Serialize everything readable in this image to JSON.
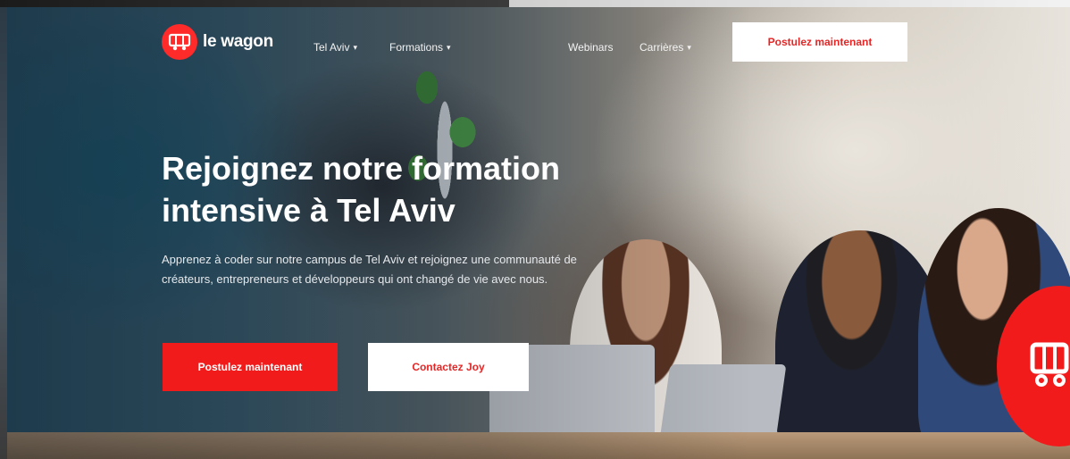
{
  "brand": {
    "name": "le wagon",
    "accent_color": "#f21b1b"
  },
  "header": {
    "nav": [
      {
        "label": "Tel Aviv",
        "has_dropdown": true
      },
      {
        "label": "Formations",
        "has_dropdown": true
      },
      {
        "label": "Webinars",
        "has_dropdown": false
      },
      {
        "label": "Carrières",
        "has_dropdown": true
      }
    ],
    "cta_label": "Postulez maintenant"
  },
  "hero": {
    "title": "Rejoignez notre formation intensive à Tel Aviv",
    "subtitle": "Apprenez à coder sur notre campus de Tel Aviv et rejoignez une communauté de créateurs, entrepreneurs et développeurs qui ont changé de vie avec nous.",
    "primary_cta": "Postulez maintenant",
    "secondary_cta": "Contactez Joy"
  },
  "icons": {
    "logo": "wagon-bus-icon",
    "dropdown": "chevron-down-icon",
    "chat": "chat-bus-icon"
  }
}
